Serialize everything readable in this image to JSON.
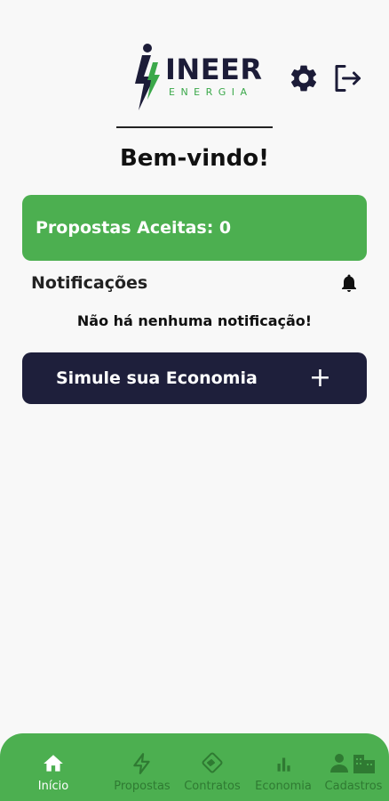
{
  "header": {
    "logo_name": "INEER",
    "logo_sub": "ENERGIA",
    "settings_icon": "gear-icon",
    "logout_icon": "logout-icon"
  },
  "welcome": "Bem-vindo!",
  "accepted_card": {
    "label": "Propostas Aceitas: 0"
  },
  "notifications": {
    "title": "Notificações",
    "icon": "bell-icon",
    "empty": "Não há nenhuma notificação!"
  },
  "simulate_button": {
    "label": "Simule sua Economia",
    "icon": "plus-icon",
    "plus": "+"
  },
  "bottom_nav": {
    "items": [
      {
        "label": "Início",
        "icon": "home-icon",
        "active": true
      },
      {
        "label": "Propostas",
        "icon": "lightning-icon",
        "active": false
      },
      {
        "label": "Contratos",
        "icon": "handshake-icon",
        "active": false
      },
      {
        "label": "Economia",
        "icon": "bar-chart-icon",
        "active": false
      },
      {
        "label": "Cadastros",
        "icon": "user-building-icon",
        "active": false
      }
    ]
  },
  "colors": {
    "brand_green": "#4caf50",
    "dark_navy": "#1e1f3b",
    "inactive_nav": "#2f7a32"
  }
}
